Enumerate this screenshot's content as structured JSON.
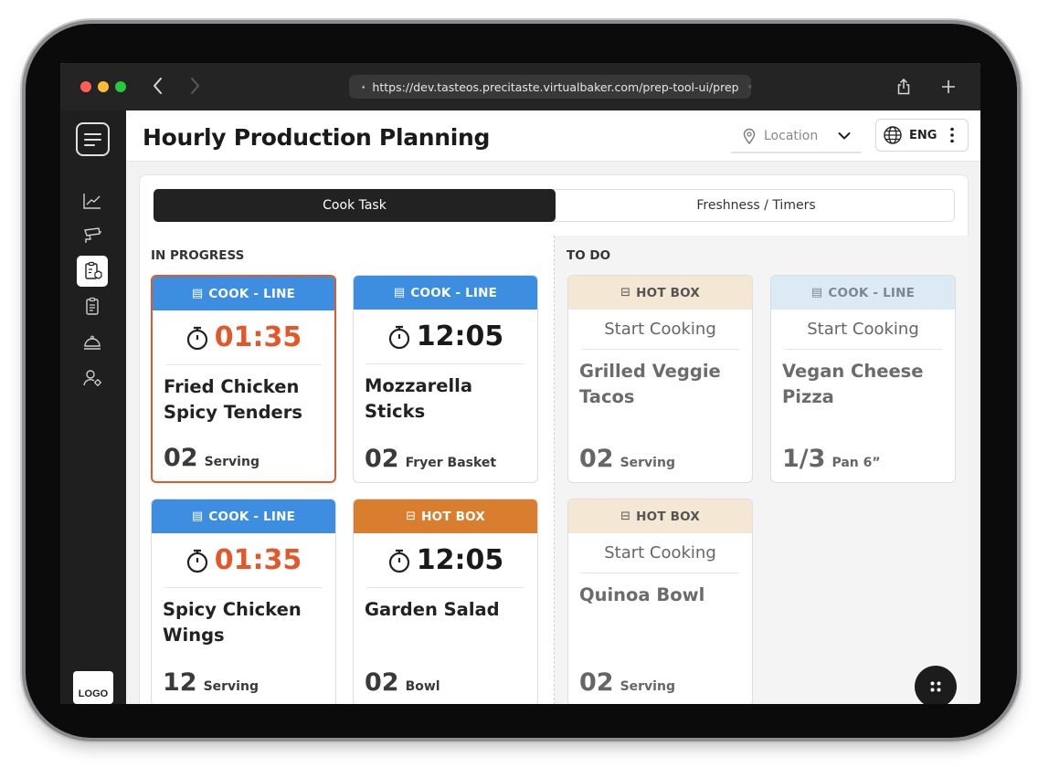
{
  "browser": {
    "url": "https://dev.tasteos.precitaste.virtualbaker.com/prep-tool-ui/prep",
    "traffic_colors": [
      "#ff5f57",
      "#febc2e",
      "#28c840"
    ]
  },
  "sidebar": {
    "items": [
      {
        "icon": "chart-line-icon"
      },
      {
        "icon": "security-camera-icon"
      },
      {
        "icon": "clipboard-tasks-icon",
        "active": true
      },
      {
        "icon": "clipboard-list-icon"
      },
      {
        "icon": "cloche-icon"
      },
      {
        "icon": "user-settings-icon"
      }
    ],
    "logo_label": "LOGO"
  },
  "header": {
    "title": "Hourly Production Planning",
    "location_placeholder": "Location",
    "language": "ENG"
  },
  "tabs": [
    {
      "label": "Cook Task",
      "active": true
    },
    {
      "label": "Freshness / Timers",
      "active": false
    }
  ],
  "in_progress": {
    "title": "IN PROGRESS",
    "cards": [
      {
        "station": "COOK - LINE",
        "station_type": "cook",
        "timer": "01:35",
        "timer_color": "#e2582b",
        "name_line1": "Fried Chicken",
        "name_line2": "Spicy Tenders",
        "qty": "02",
        "unit": "Serving",
        "highlight": true
      },
      {
        "station": "COOK - LINE",
        "station_type": "cook",
        "timer": "12:05",
        "timer_color": "#1a1a1a",
        "name_line1": "Mozzarella Sticks",
        "name_line2": "",
        "qty": "02",
        "unit": "Fryer Basket"
      },
      {
        "station": "COOK - LINE",
        "station_type": "cook",
        "timer": "01:35",
        "timer_color": "#e2582b",
        "name_line1": "Spicy Chicken",
        "name_line2": "Wings",
        "qty": "12",
        "unit": "Serving"
      },
      {
        "station": "HOT BOX",
        "station_type": "hot",
        "timer": "12:05",
        "timer_color": "#1a1a1a",
        "name_line1": "Garden Salad",
        "name_line2": "",
        "qty": "02",
        "unit": "Bowl"
      }
    ]
  },
  "todo": {
    "title": "TO DO",
    "cards": [
      {
        "station": "HOT BOX",
        "station_type": "hot",
        "action": "Start Cooking",
        "name_line1": "Grilled Veggie",
        "name_line2": "Tacos",
        "qty": "02",
        "unit": "Serving"
      },
      {
        "station": "COOK - LINE",
        "station_type": "cook",
        "action": "Start Cooking",
        "name_line1": "Vegan Cheese",
        "name_line2": "Pizza",
        "qty": "1/3",
        "unit": "Pan 6”"
      },
      {
        "station": "HOT BOX",
        "station_type": "hot",
        "action": "Start Cooking",
        "name_line1": "Quinoa Bowl",
        "name_line2": "",
        "qty": "02",
        "unit": "Serving"
      }
    ]
  },
  "colors": {
    "cook_line": "#3d8ee0",
    "hot_box": "#d97d2e",
    "alert_timer": "#e2582b"
  }
}
